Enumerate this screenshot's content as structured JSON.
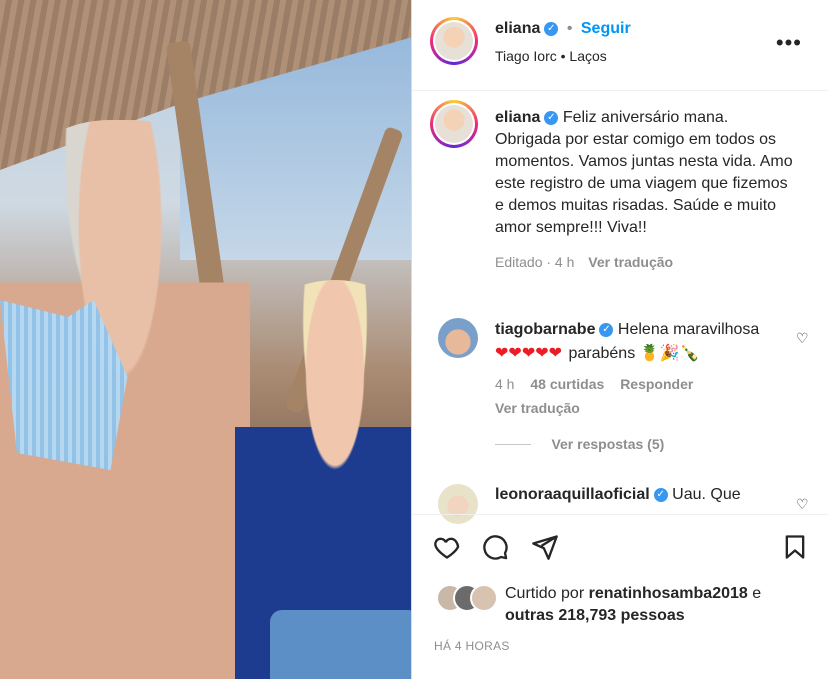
{
  "header": {
    "username": "eliana",
    "follow_label": "Seguir",
    "dot": "•",
    "subtitle": "Tiago Iorc • Laços",
    "more_label": "•••"
  },
  "caption": {
    "username": "eliana",
    "text": "Feliz aniversário mana. Obrigada por estar comigo em todos os momentos. Vamos juntas nesta vida. Amo este registro de uma viagem que fizemos e demos muitas risadas. Saúde e muito amor sempre!!! Viva!!",
    "edited": "Editado · 4 h",
    "translate": "Ver tradução"
  },
  "comments": [
    {
      "username": "tiagobarnabe",
      "text_line1": "Helena maravilhosa",
      "hearts": "❤❤❤❤❤",
      "text_line2": "parabéns",
      "emoji": "🍍🎉🍾",
      "time": "4 h",
      "likes": "48 curtidas",
      "reply": "Responder",
      "translate": "Ver tradução",
      "view_replies": "Ver respostas (5)"
    },
    {
      "username": "leonoraaquillaoficial",
      "text": "Uau. Que"
    }
  ],
  "actions": {
    "liked_by_prefix": "Curtido por",
    "liked_by_user": "renatinhosamba2018",
    "liked_by_suffix": "e",
    "others": "outras 218,793 pessoas",
    "timestamp": "HÁ 4 HORAS"
  },
  "icons": [
    "heart-icon",
    "comment-icon",
    "share-icon",
    "bookmark-icon",
    "verified-icon",
    "more-icon"
  ],
  "colors": {
    "link": "#0095f6",
    "verified": "#3897f0",
    "text": "#262626",
    "muted": "#8e8e8e"
  }
}
